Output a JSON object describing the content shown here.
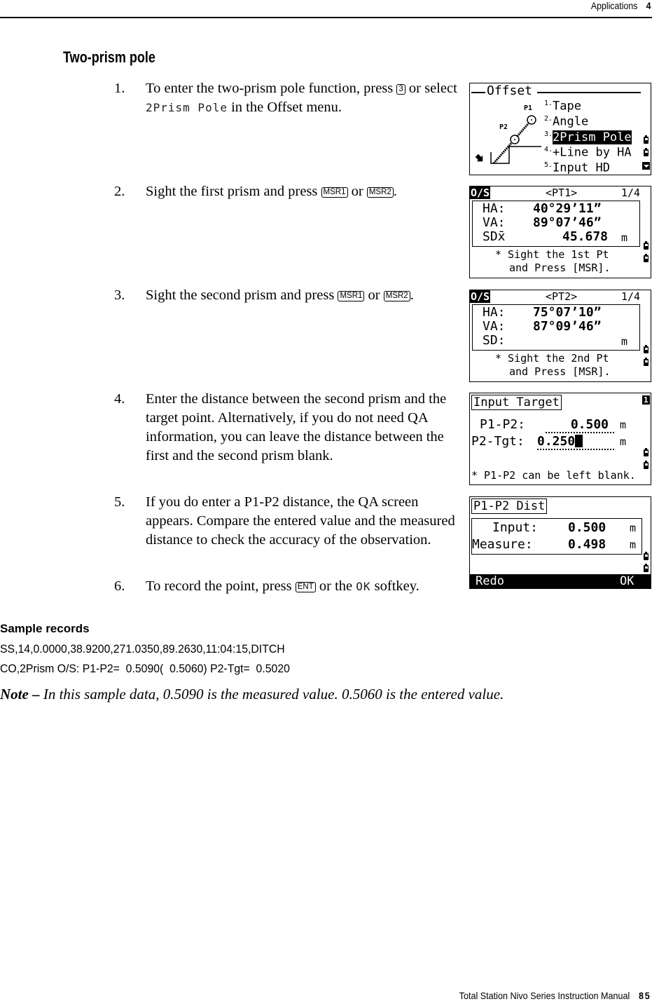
{
  "header": {
    "section": "Applications",
    "chapter": "4"
  },
  "title": "Two-prism pole",
  "steps": [
    {
      "num": "1.",
      "parts": [
        "To enter the two-prism pole function, press ",
        " or select ",
        " in the Offset menu."
      ],
      "key": "3",
      "lcd": "2Prism Pole"
    },
    {
      "num": "2.",
      "parts": [
        "Sight the first prism and press ",
        " or ",
        "."
      ],
      "keys": [
        "MSR1",
        "MSR2"
      ]
    },
    {
      "num": "3.",
      "parts": [
        "Sight the second prism and press ",
        " or ",
        "."
      ],
      "keys": [
        "MSR1",
        "MSR2"
      ]
    },
    {
      "num": "4.",
      "text": "Enter the distance between the second prism and the target point. Alternatively, if you do not need QA information, you can leave the distance between the first and the second prism blank."
    },
    {
      "num": "5.",
      "text": "If you do enter a P1-P2 distance, the QA screen appears. Compare the entered value and the measured distance to check the accuracy of the observation."
    },
    {
      "num": "6.",
      "parts": [
        "To record the point, press ",
        " or the ",
        " softkey."
      ],
      "key": "ENT",
      "lcd": "OK"
    }
  ],
  "screens": {
    "offset": {
      "title": "Offset",
      "diagram_labels": [
        "P1",
        "P2"
      ],
      "items": [
        {
          "num": "1.",
          "label": "Tape"
        },
        {
          "num": "2.",
          "label": "Angle"
        },
        {
          "num": "3.",
          "label": "2Prism Pole",
          "selected": true
        },
        {
          "num": "4.",
          "label": "+Line by HA"
        },
        {
          "num": "5.",
          "label": "Input HD"
        }
      ]
    },
    "pt1": {
      "mode": "O/S",
      "point": "<PT1>",
      "page": "1/4",
      "rows": [
        {
          "label": "HA:",
          "value": "40°29’11”",
          "unit": ""
        },
        {
          "label": "VA:",
          "value": "89°07’46”",
          "unit": ""
        },
        {
          "label": "SDx̄",
          "value": "45.678",
          "unit": "m"
        }
      ],
      "message": [
        "* Sight the 1st Pt",
        "and Press [MSR]."
      ]
    },
    "pt2": {
      "mode": "O/S",
      "point": "<PT2>",
      "page": "1/4",
      "rows": [
        {
          "label": "HA:",
          "value": "75°07’10”",
          "unit": ""
        },
        {
          "label": "VA:",
          "value": "87°09’46”",
          "unit": ""
        },
        {
          "label": "SD:",
          "value": "",
          "unit": "m"
        }
      ],
      "message": [
        "* Sight the 2nd Pt",
        "and Press [MSR]."
      ]
    },
    "input_target": {
      "title": "Input Target",
      "input_mode": "1",
      "fields": [
        {
          "label": "P1-P2:",
          "value": "0.500",
          "unit": "m"
        },
        {
          "label": "P2-Tgt:",
          "value": "0.250",
          "unit": "m"
        }
      ],
      "message": "* P1-P2 can be left blank."
    },
    "dist": {
      "title": "P1-P2 Dist",
      "rows": [
        {
          "label": "Input:",
          "value": "0.500",
          "unit": "m"
        },
        {
          "label": "Measure:",
          "value": "0.498",
          "unit": "m"
        }
      ],
      "softkeys": [
        "Redo",
        "OK"
      ]
    }
  },
  "sample": {
    "heading": "Sample records",
    "lines": [
      "SS,14,0.0000,38.9200,271.0350,89.2630,11:04:15,DITCH",
      "CO,2Prism O/S: P1-P2=  0.5090(  0.5060) P2-Tgt=  0.5020"
    ]
  },
  "note": {
    "label": "Note –",
    "text": " In this sample data, 0.5090 is the measured value. 0.5060 is the entered value."
  },
  "footer": {
    "manual": "Total Station Nivo Series Instruction Manual",
    "page": "85"
  }
}
